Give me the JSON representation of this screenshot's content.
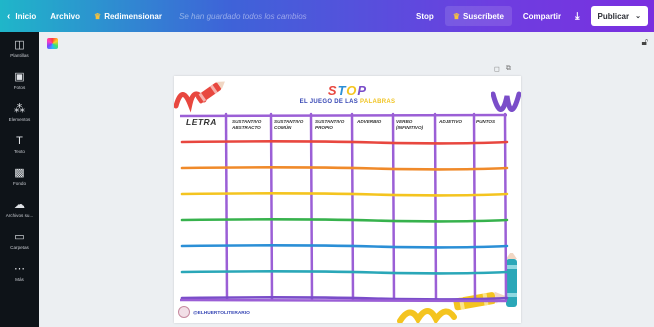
{
  "topbar": {
    "back_label": "Inicio",
    "file_label": "Archivo",
    "resize_label": "Redimensionar",
    "saved_status": "Se han guardado todos los cambios",
    "doc_title": "Stop",
    "subscribe_label": "Suscríbete",
    "share_label": "Compartir",
    "publish_label": "Publicar"
  },
  "sidebar": {
    "items": [
      {
        "label": "Plantillas",
        "icon": "templates-icon"
      },
      {
        "label": "Fotos",
        "icon": "photos-icon"
      },
      {
        "label": "Elementos",
        "icon": "elements-icon"
      },
      {
        "label": "Texto",
        "icon": "text-icon"
      },
      {
        "label": "Fondo",
        "icon": "background-icon"
      },
      {
        "label": "Archivos su...",
        "icon": "uploads-icon"
      },
      {
        "label": "Carpetas",
        "icon": "folders-icon"
      },
      {
        "label": "Más",
        "icon": "more-icon"
      }
    ]
  },
  "design": {
    "title": "STOP",
    "subtitle_before": "EL JUEGO DE LAS ",
    "subtitle_highlight": "PALABRAS",
    "columns": [
      "LETRA",
      "SUSTANTIVO ABSTRACTO",
      "SUSTANTIVO COMÚN",
      "SUSTANTIVO PROPIO",
      "ADVERBIO",
      "VERBO (INFINITIVO)",
      "ADJETIVO",
      "PUNTOS"
    ],
    "author": "@ELHUERTOLITERARIO",
    "row_colors": [
      "#e8473f",
      "#f08a2a",
      "#f4c41f",
      "#37b24d",
      "#2b8fd6",
      "#2aa7b8",
      "#7a4dc9"
    ],
    "grid_color": "#9b5fd6"
  }
}
